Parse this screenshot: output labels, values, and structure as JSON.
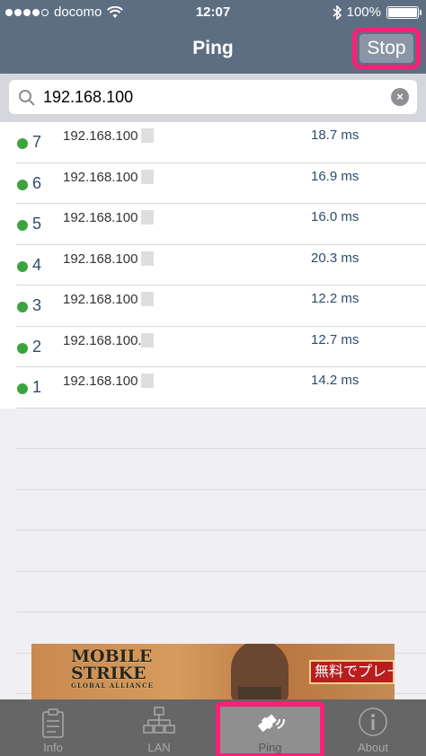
{
  "status_bar": {
    "carrier": "docomo",
    "time": "12:07",
    "battery": "100%",
    "battery_level": 1.0
  },
  "nav": {
    "title": "Ping",
    "stop_label": "Stop"
  },
  "search": {
    "value": "192.168.100"
  },
  "results": [
    {
      "seq": "7",
      "ip": "192.168.100",
      "time": "18.7 ms"
    },
    {
      "seq": "6",
      "ip": "192.168.100",
      "time": "16.9 ms"
    },
    {
      "seq": "5",
      "ip": "192.168.100",
      "time": "16.0 ms"
    },
    {
      "seq": "4",
      "ip": "192.168.100",
      "time": "20.3 ms"
    },
    {
      "seq": "3",
      "ip": "192.168.100",
      "time": "12.2 ms"
    },
    {
      "seq": "2",
      "ip": "192.168.100.",
      "time": "12.7 ms"
    },
    {
      "seq": "1",
      "ip": "192.168.100",
      "time": "14.2 ms"
    }
  ],
  "ad": {
    "logo_line1": "MOBILE",
    "logo_line2": "STRIKE",
    "logo_line3": "GLOBAL ALLIANCE",
    "cta": "無料でプレー"
  },
  "tabs": [
    {
      "label": "Info",
      "icon": "clipboard-icon"
    },
    {
      "label": "LAN",
      "icon": "network-icon"
    },
    {
      "label": "Ping",
      "icon": "satellite-icon"
    },
    {
      "label": "About",
      "icon": "info-circle-icon"
    }
  ],
  "colors": {
    "nav_bg": "#5e6e82",
    "highlight": "#ff1f77",
    "status_dot": "#3da33d",
    "value_text": "#2f4c6b",
    "tabbar_bg": "#666666"
  }
}
